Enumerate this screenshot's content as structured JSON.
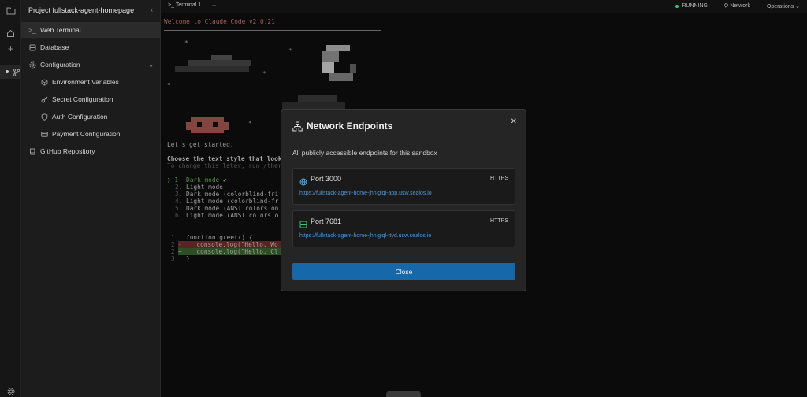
{
  "sidebar": {
    "project_title": "Project fullstack-agent-homepage",
    "items": [
      {
        "label": "Web Terminal",
        "icon": "terminal-icon"
      },
      {
        "label": "Database",
        "icon": "database-icon"
      },
      {
        "label": "Configuration",
        "icon": "gear-icon"
      },
      {
        "label": "Environment Variables",
        "icon": "cube-icon"
      },
      {
        "label": "Secret Configuration",
        "icon": "key-icon"
      },
      {
        "label": "Auth Configuration",
        "icon": "shield-icon"
      },
      {
        "label": "Payment Configuration",
        "icon": "card-icon"
      },
      {
        "label": "GitHub Repository",
        "icon": "book-icon"
      }
    ]
  },
  "terminal_header": {
    "tab_label": "Terminal 1",
    "status": "RUNNING",
    "network_label": "Network",
    "operations_label": "Operations"
  },
  "terminal": {
    "welcome": "Welcome to Claude Code v2.0.21",
    "lets_start": "Let's get started.",
    "choose_style": "Choose the text style that look",
    "change_hint": "To change this later, run /ther",
    "options": [
      "Dark mode ✔",
      "Light mode",
      "Dark mode (colorblind-fri",
      "Light mode (colorblind-fr",
      "Dark mode (ANSI colors on",
      "Light mode (ANSI colors o"
    ],
    "code": [
      {
        "num": "1",
        "mark": " ",
        "text": "function greet() {"
      },
      {
        "num": "2",
        "mark": "-",
        "text": "  console.log(\"Hello, Wo"
      },
      {
        "num": "2",
        "mark": "+",
        "text": "  console.log(\"Hello, Cl"
      },
      {
        "num": "3",
        "mark": " ",
        "text": "}"
      }
    ]
  },
  "modal": {
    "title": "Network Endpoints",
    "description": "All publicly accessible endpoints for this sandbox",
    "endpoints": [
      {
        "port": "Port 3000",
        "protocol": "HTTPS",
        "url": "https://fullstack-agent-home-jhnigiql-app.usw.sealos.io"
      },
      {
        "port": "Port 7681",
        "protocol": "HTTPS",
        "url": "https://fullstack-agent-home-jhnigiql-ttyd.usw.sealos.io"
      }
    ],
    "close_label": "Close"
  },
  "colors": {
    "accent": "#1768a8",
    "running": "#2ecc71",
    "link": "#4f95d6",
    "welcome": "#d77a6a"
  }
}
